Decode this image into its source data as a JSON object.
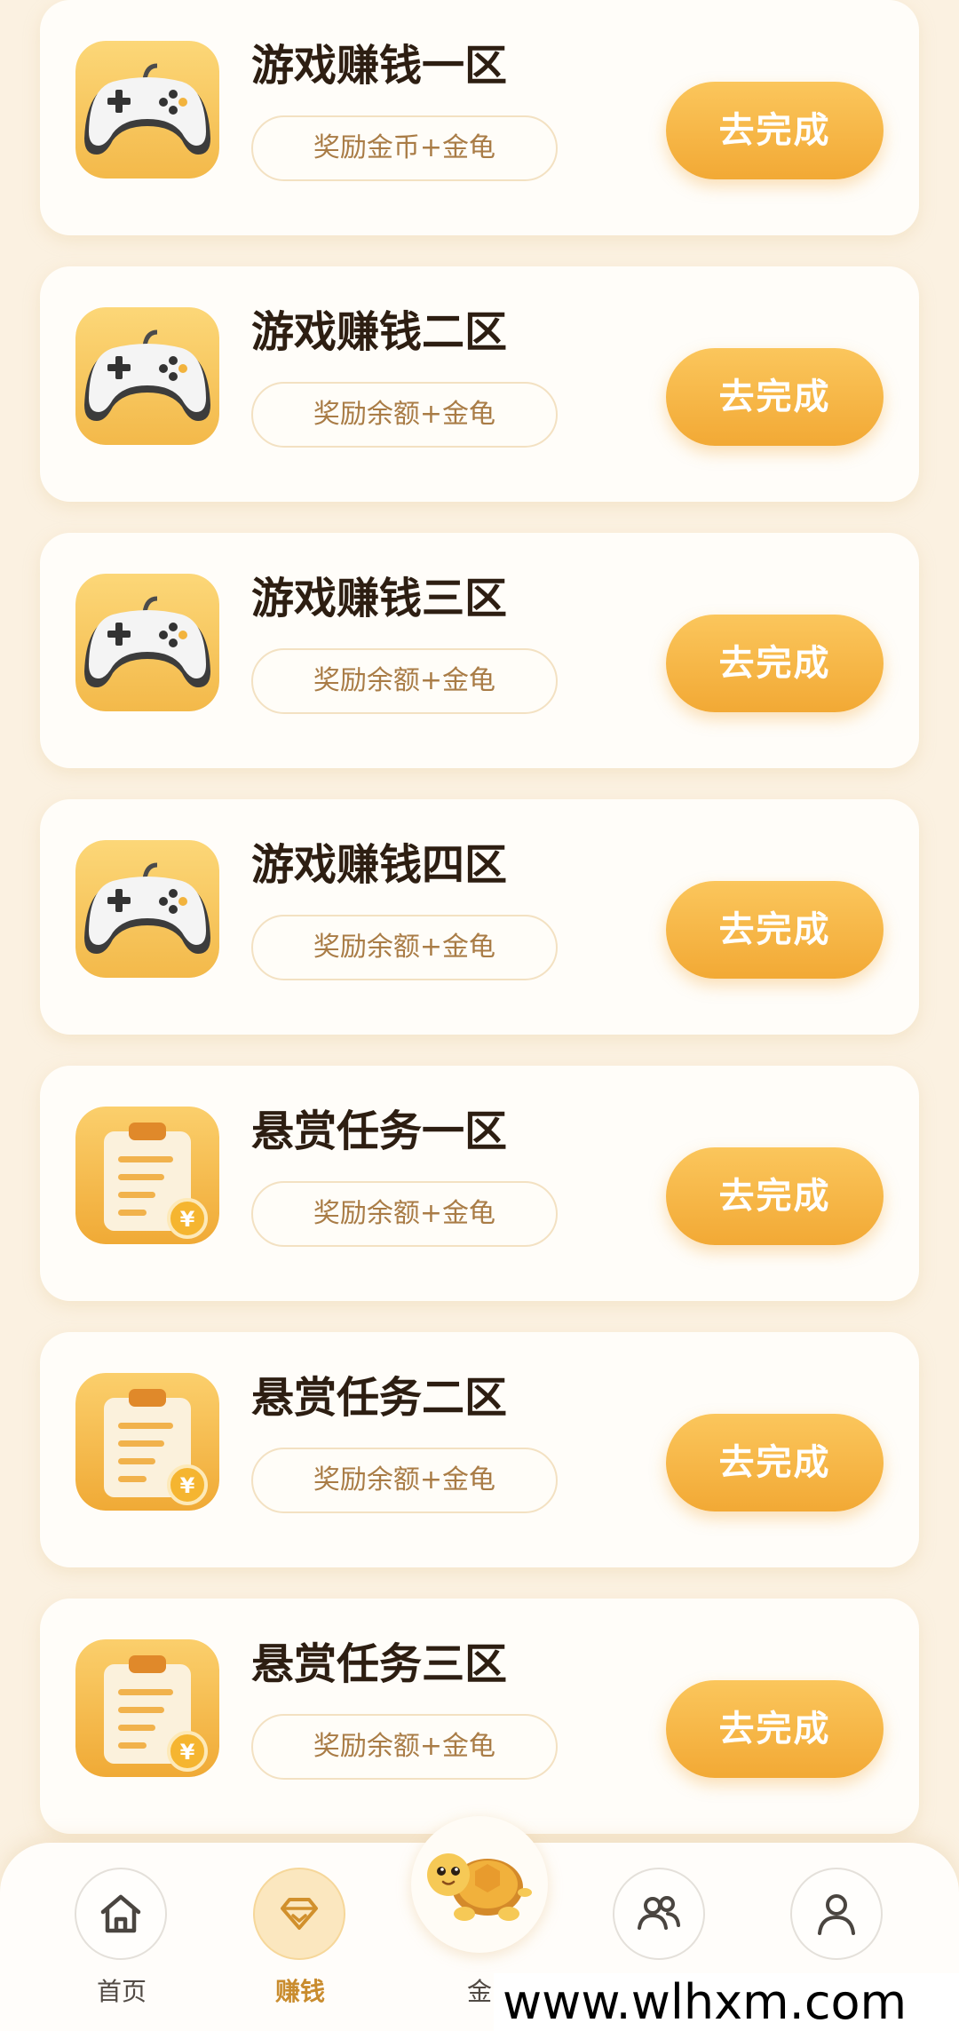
{
  "tasks": [
    {
      "title": "游戏赚钱一区",
      "reward": "奖励金币+金龟",
      "button": "去完成",
      "icon": "gamepad-icon"
    },
    {
      "title": "游戏赚钱二区",
      "reward": "奖励余额+金龟",
      "button": "去完成",
      "icon": "gamepad-icon"
    },
    {
      "title": "游戏赚钱三区",
      "reward": "奖励余额+金龟",
      "button": "去完成",
      "icon": "gamepad-icon"
    },
    {
      "title": "游戏赚钱四区",
      "reward": "奖励余额+金龟",
      "button": "去完成",
      "icon": "gamepad-icon"
    },
    {
      "title": "悬赏任务一区",
      "reward": "奖励余额+金龟",
      "button": "去完成",
      "icon": "clipboard-coin-icon"
    },
    {
      "title": "悬赏任务二区",
      "reward": "奖励余额+金龟",
      "button": "去完成",
      "icon": "clipboard-coin-icon"
    },
    {
      "title": "悬赏任务三区",
      "reward": "奖励余额+金龟",
      "button": "去完成",
      "icon": "clipboard-coin-icon"
    }
  ],
  "nav": {
    "home": {
      "label": "首页",
      "icon": "home-icon"
    },
    "earn": {
      "label": "赚钱",
      "icon": "diamond-icon",
      "active": true
    },
    "turtle": {
      "label": "金",
      "icon": "turtle-icon"
    },
    "team": {
      "icon": "people-icon"
    },
    "profile": {
      "icon": "person-icon"
    }
  },
  "watermark": "www.wlhxm.com",
  "colors": {
    "background": "#fbf1e1",
    "card": "#fffdf9",
    "title": "#2d1e12",
    "reward_text": "#a97c46",
    "button_top": "#fbc65c",
    "button_bottom": "#f2a935",
    "nav_active": "#c98c2e"
  }
}
